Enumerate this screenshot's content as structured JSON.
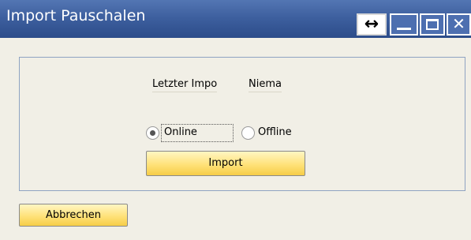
{
  "window": {
    "title": "Import Pauschalen",
    "controls": {
      "resize_glyph": "↔",
      "close_glyph": "✕"
    }
  },
  "form": {
    "last_import_label": "Letzter Impo",
    "last_import_value": "Niema",
    "mode_options": [
      {
        "label": "Online",
        "selected": true
      },
      {
        "label": "Offline",
        "selected": false
      }
    ],
    "import_button": "Import"
  },
  "footer": {
    "cancel_button": "Abbrechen"
  }
}
